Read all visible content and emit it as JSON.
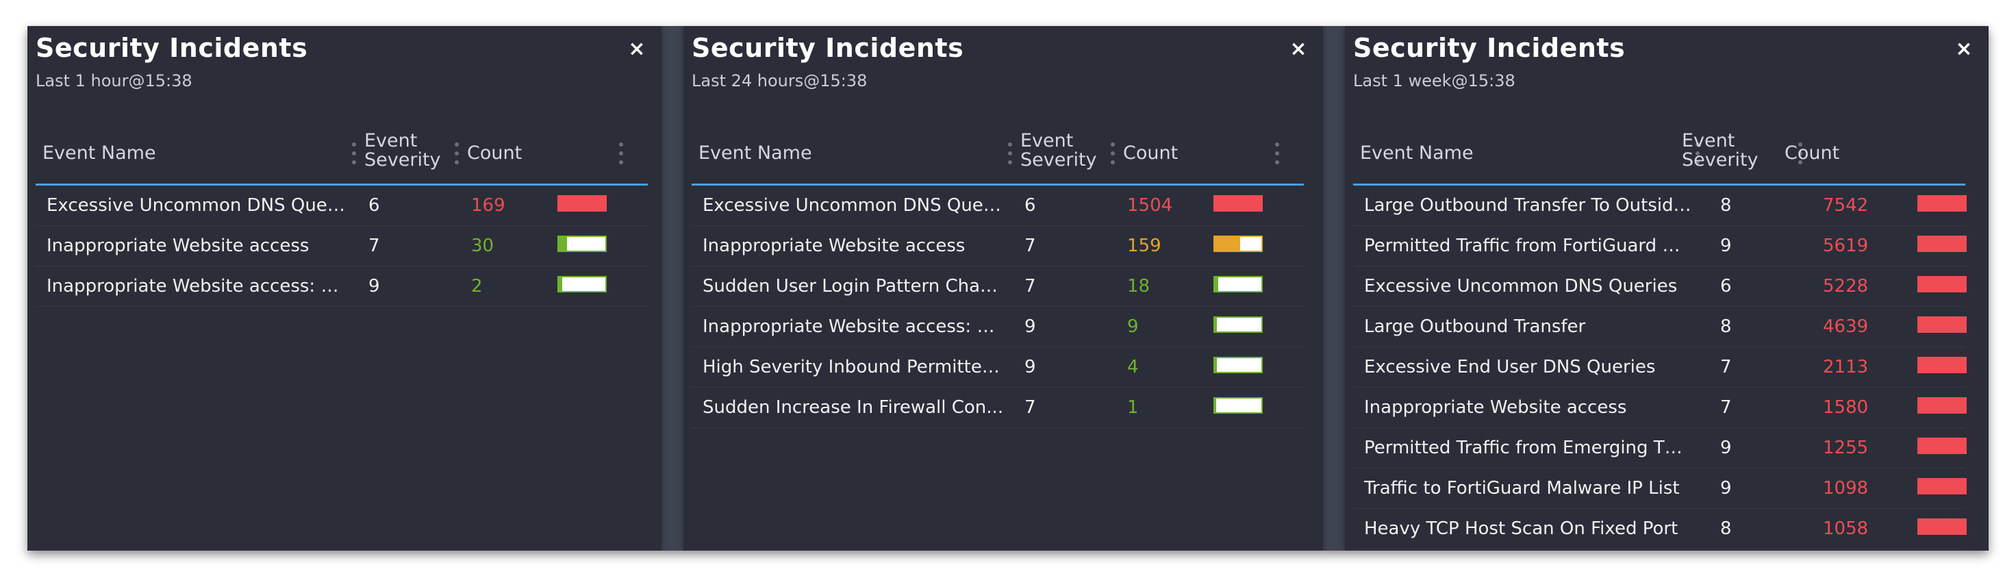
{
  "colors": {
    "high": "#f04c55",
    "medium": "#e6a42a",
    "low": "#6fb22e",
    "accent_line": "#4a9fe0"
  },
  "panels": [
    {
      "title": "Security Incidents",
      "subtitle": "Last 1 hour@15:38",
      "close_icon": "×",
      "columns": {
        "name": "Event Name",
        "severity_line1": "Event",
        "severity_line2": "Severity",
        "count": "Count"
      },
      "rows": [
        {
          "name": "Excessive Uncommon DNS Queries",
          "severity": "6",
          "count": "169",
          "level": "high",
          "fill": 1.0
        },
        {
          "name": "Inappropriate Website access",
          "severity": "7",
          "count": "30",
          "level": "low",
          "fill": 0.18
        },
        {
          "name": "Inappropriate Website access: Hi...",
          "severity": "9",
          "count": "2",
          "level": "low",
          "fill": 0.08
        }
      ]
    },
    {
      "title": "Security Incidents",
      "subtitle": "Last 24 hours@15:38",
      "close_icon": "×",
      "columns": {
        "name": "Event Name",
        "severity_line1": "Event",
        "severity_line2": "Severity",
        "count": "Count"
      },
      "rows": [
        {
          "name": "Excessive Uncommon DNS Queries",
          "severity": "6",
          "count": "1504",
          "level": "high",
          "fill": 1.0
        },
        {
          "name": "Inappropriate Website access",
          "severity": "7",
          "count": "159",
          "level": "medium",
          "fill": 0.55
        },
        {
          "name": "Sudden User Login Pattern Change",
          "severity": "7",
          "count": "18",
          "level": "low",
          "fill": 0.07
        },
        {
          "name": "Inappropriate Website access: Hi...",
          "severity": "9",
          "count": "9",
          "level": "low",
          "fill": 0.05
        },
        {
          "name": "High Severity Inbound Permitted...",
          "severity": "9",
          "count": "4",
          "level": "low",
          "fill": 0.04
        },
        {
          "name": "Sudden Increase In Firewall Con...",
          "severity": "7",
          "count": "1",
          "level": "low",
          "fill": 0.03
        }
      ]
    },
    {
      "title": "Security Incidents",
      "subtitle": "Last 1 week@15:38",
      "close_icon": "×",
      "columns": {
        "name": "Event Name",
        "severity_line1": "Event",
        "severity_line2": "Severity",
        "count": "Count"
      },
      "rows": [
        {
          "name": "Large Outbound Transfer To Outside ...",
          "severity": "8",
          "count": "7542",
          "level": "high",
          "fill": 1.0
        },
        {
          "name": "Permitted Traffic from FortiGuard Ma...",
          "severity": "9",
          "count": "5619",
          "level": "high",
          "fill": 1.0
        },
        {
          "name": "Excessive Uncommon DNS Queries",
          "severity": "6",
          "count": "5228",
          "level": "high",
          "fill": 1.0
        },
        {
          "name": "Large Outbound Transfer",
          "severity": "8",
          "count": "4639",
          "level": "high",
          "fill": 1.0
        },
        {
          "name": "Excessive End User DNS Queries",
          "severity": "7",
          "count": "2113",
          "level": "high",
          "fill": 1.0
        },
        {
          "name": "Inappropriate Website access",
          "severity": "7",
          "count": "1580",
          "level": "high",
          "fill": 1.0
        },
        {
          "name": "Permitted Traffic from Emerging Thr...",
          "severity": "9",
          "count": "1255",
          "level": "high",
          "fill": 1.0
        },
        {
          "name": "Traffic to FortiGuard Malware IP List",
          "severity": "9",
          "count": "1098",
          "level": "high",
          "fill": 1.0
        },
        {
          "name": "Heavy TCP Host Scan On Fixed Port",
          "severity": "8",
          "count": "1058",
          "level": "high",
          "fill": 1.0
        },
        {
          "name": "",
          "severity": "",
          "count": "",
          "level": "high",
          "fill": 1.0
        }
      ]
    }
  ]
}
